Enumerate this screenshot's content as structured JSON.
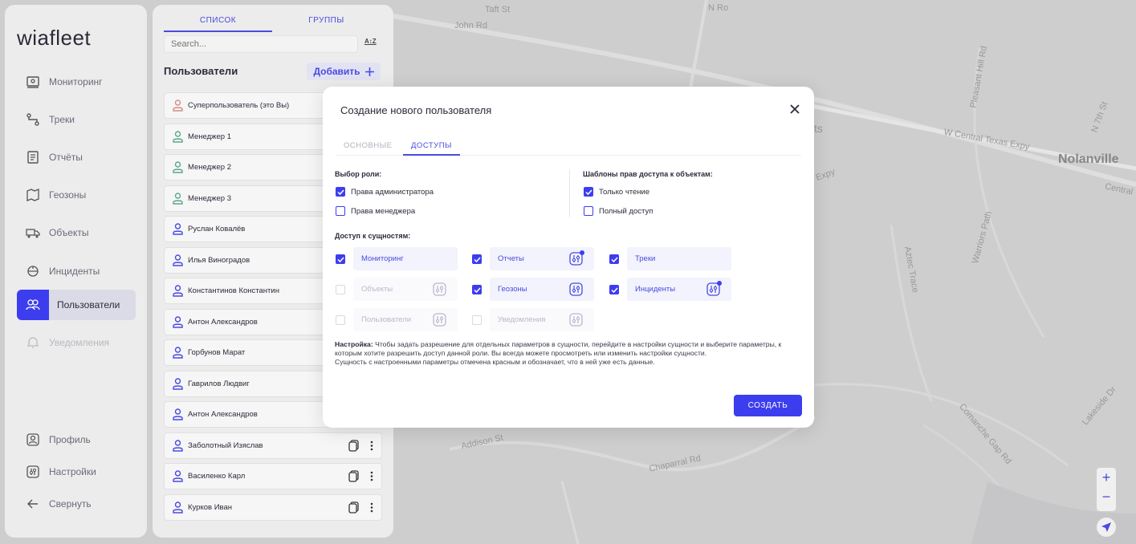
{
  "app": {
    "logo": "wiafleet"
  },
  "sidebar": {
    "items": [
      {
        "label": "Мониторинг",
        "icon": "monitoring-icon"
      },
      {
        "label": "Треки",
        "icon": "tracks-icon"
      },
      {
        "label": "Отчёты",
        "icon": "reports-icon"
      },
      {
        "label": "Геозоны",
        "icon": "geozones-icon"
      },
      {
        "label": "Объекты",
        "icon": "truck-icon"
      },
      {
        "label": "Инциденты",
        "icon": "incident-icon"
      },
      {
        "label": "Пользователи",
        "icon": "users-icon",
        "active": true
      },
      {
        "label": "Уведомления",
        "icon": "bell-icon",
        "disabled": true
      }
    ],
    "bottom": [
      {
        "label": "Профиль",
        "icon": "profile-icon"
      },
      {
        "label": "Настройки",
        "icon": "settings-icon"
      },
      {
        "label": "Свернуть",
        "icon": "arrow-left-icon"
      }
    ]
  },
  "panel": {
    "tabs": [
      "СПИСОК",
      "ГРУППЫ"
    ],
    "search_placeholder": "Search...",
    "sort_label": "A↕Z",
    "title": "Пользователи",
    "add_label": "Добавить",
    "users": [
      {
        "name": "Суперпользователь (это Вы)",
        "super": true
      },
      {
        "name": "Менеджер 1"
      },
      {
        "name": "Менеджер 2"
      },
      {
        "name": "Менеджер 3"
      },
      {
        "name": "Руслан Ковалёв"
      },
      {
        "name": "Илья Виноградов"
      },
      {
        "name": "Константинов Константин"
      },
      {
        "name": "Антон Александров"
      },
      {
        "name": "Горбунов Марат"
      },
      {
        "name": "Гаврилов Людвиг"
      },
      {
        "name": "Антон Александров"
      },
      {
        "name": "Заболотный Изяслав"
      },
      {
        "name": "Василенко Карл"
      },
      {
        "name": "Курков Иван"
      }
    ]
  },
  "modal": {
    "title": "Создание нового пользователя",
    "tabs": {
      "basic": "ОСНОВНЫЕ",
      "access": "ДОСТУПЫ"
    },
    "role_title": "Выбор роли:",
    "roles": [
      {
        "label": "Права администратора",
        "checked": true
      },
      {
        "label": "Права менеджера",
        "checked": false
      }
    ],
    "templates_title": "Шаблоны прав доступа к объектам:",
    "templates": [
      {
        "label": "Только чтение",
        "checked": true
      },
      {
        "label": "Полный доступ",
        "checked": false
      }
    ],
    "entities_title": "Доступ к сущностям:",
    "entities": [
      {
        "label": "Мониторинг",
        "checked": true,
        "gear": false,
        "marked": false
      },
      {
        "label": "Отчеты",
        "checked": true,
        "gear": true,
        "marked": true
      },
      {
        "label": "Треки",
        "checked": true,
        "gear": false,
        "marked": false
      },
      {
        "label": "Объекты",
        "checked": false,
        "gear": true,
        "marked": false
      },
      {
        "label": "Геозоны",
        "checked": true,
        "gear": true,
        "marked": false
      },
      {
        "label": "Инциденты",
        "checked": true,
        "gear": true,
        "marked": true
      },
      {
        "label": "Пользователи",
        "checked": false,
        "gear": true,
        "marked": false
      },
      {
        "label": "Уведомления",
        "checked": false,
        "gear": true,
        "marked": false
      }
    ],
    "note_bold": "Настройка:",
    "note_text": " Чтобы задать разрешение для отдельных параметров в сущности, перейдите в настройки сущности и выберите параметры, к которым хотите разрешить доступ данной роли. Вы всегда можете просмотреть или изменить настройки сущности.",
    "note_text2": "Сущность с настроенными параметры отмечена красным и обозначает, что в ней уже есть данные.",
    "create_label": "СОЗДАТЬ"
  },
  "map": {
    "labels": [
      "Taft St",
      "John Rd",
      "N Ro",
      "Pleasant Hill Rd",
      "N 7th St",
      "W Central Texas Expy",
      "Central",
      "Warriors Path",
      "Aztec Trace",
      "Addison St",
      "Chaparral Rd",
      "Comanche Gap Rd",
      "Lakeside Dr",
      "Expy",
      "ts"
    ],
    "city": "Nolanville",
    "zoom_in": "+",
    "zoom_out": "−"
  },
  "colors": {
    "accent": "#3d3df0",
    "accent_text": "#4a4ae0"
  }
}
